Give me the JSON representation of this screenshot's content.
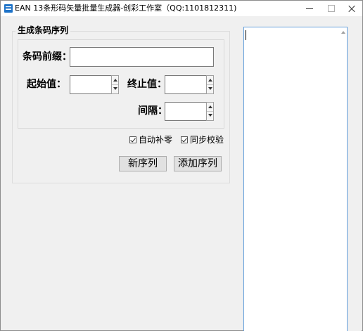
{
  "window": {
    "title": "EAN 13条形码矢量批量生成器-创彩工作室（QQ:1101812311)"
  },
  "group": {
    "legend": "生成条码序列",
    "prefix_label": "条码前缀：",
    "prefix_value": "",
    "start_label": "起始值：",
    "start_value": "",
    "end_label": "终止值：",
    "end_value": "",
    "interval_label": "间隔：",
    "interval_value": "",
    "auto_pad_label": "自动补零",
    "auto_pad_checked": true,
    "sync_check_label": "同步校验",
    "sync_check_checked": true,
    "new_sequence_button": "新序列",
    "add_sequence_button": "添加序列"
  },
  "output": {
    "content": ""
  },
  "icons": {
    "app": "barcode-app-icon",
    "minimize": "minimize-icon",
    "maximize": "maximize-icon",
    "close": "close-icon"
  }
}
